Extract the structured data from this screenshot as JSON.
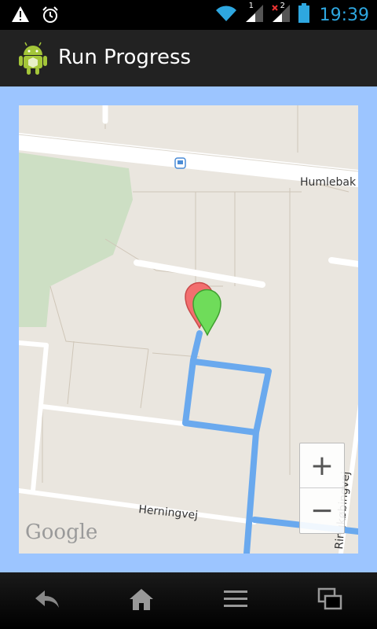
{
  "status_bar": {
    "time": "19:39",
    "icons": [
      "warning-icon",
      "alarm-icon",
      "wifi-icon",
      "signal-icon",
      "signal-no-data-icon",
      "battery-icon"
    ],
    "sim_labels": [
      "1",
      "2"
    ],
    "accent_color": "#2ea7e0"
  },
  "app": {
    "title": "Run Progress",
    "icon": "android-icon"
  },
  "map": {
    "background_color": "#9cc5ff",
    "route_color": "#6aa9ee",
    "streets": {
      "top": "Humlebak",
      "bottom": "Herningvej",
      "right": "Ringkøbingvej"
    },
    "markers": [
      {
        "name": "start-marker",
        "color": "#f26f6f"
      },
      {
        "name": "current-marker",
        "color": "#6fdc5a"
      }
    ],
    "zoom": {
      "in_label": "+",
      "out_label": "−"
    },
    "attribution": "Google"
  },
  "nav_bar": {
    "buttons": [
      "back-icon",
      "home-icon",
      "menu-icon",
      "recent-apps-icon"
    ]
  }
}
